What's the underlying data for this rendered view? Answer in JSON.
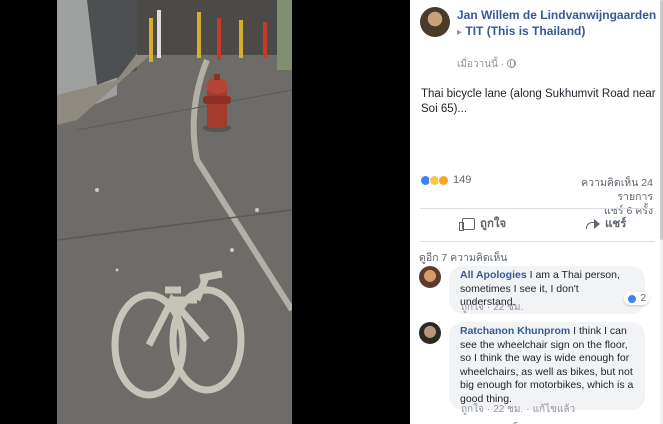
{
  "post": {
    "author": "Jan Willem de Lindvanwijngaarden",
    "arrow": "▸",
    "group": "TIT (This is Thailand)",
    "timestamp": "เมื่อวานนี้ ·",
    "text": "Thai bicycle lane (along Sukhumvit Road near Soi 65)...",
    "reactions_count": "149",
    "comments_count": "ความคิดเห็น 24 รายการ",
    "shares_count": "แชร์ 6 ครั้ง",
    "like_label": "ถูกใจ",
    "share_label": "แชร์"
  },
  "comments_section": {
    "view_more": "ดูอีก 7 ความคิดเห็น",
    "cut_off_text": "ร"
  },
  "comments": [
    {
      "name": "All Apologies",
      "text": "I am a Thai person, sometimes I see it, I don't understand.",
      "like_label": "ถูกใจ",
      "time": "22 ชม.",
      "reaction_count": "2"
    },
    {
      "name": "Ratchanon Khunprom",
      "text": "I think I can see the wheelchair sign on the floor, so I think the way is wide enough for wheelchairs, as well as bikes, but not big enough for motorbikes, which is a good thing.",
      "like_label": "ถูกใจ",
      "time": "22 ชม.",
      "edited": "แก้ไขแล้ว"
    }
  ],
  "colors": {
    "link_blue": "#385898",
    "meta_gray": "#90949c",
    "bubble_bg": "#f2f3f5",
    "pavement": "#6c6b67",
    "hydrant_red": "#a63a2b"
  },
  "icons": [
    "globe-icon",
    "like-icon",
    "share-icon",
    "like-reaction-icon",
    "haha-reaction-icon",
    "wow-reaction-icon",
    "fire-hydrant"
  ]
}
